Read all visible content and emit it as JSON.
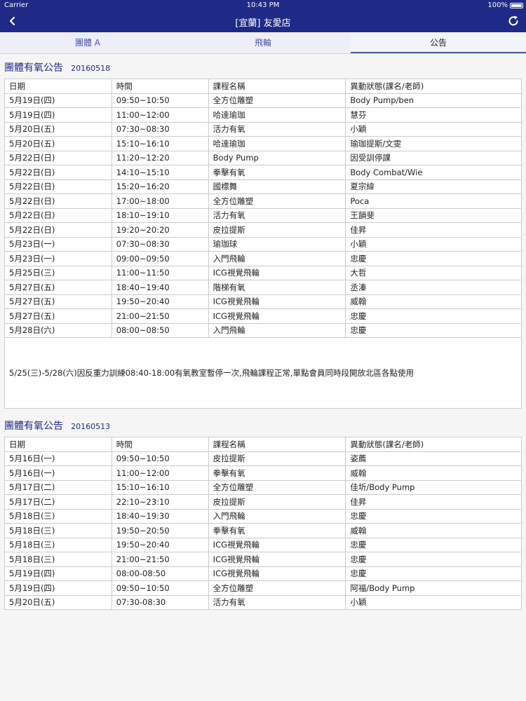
{
  "status_bar": {
    "carrier": "Carrier",
    "time": "10:43 PM",
    "battery": "100%"
  },
  "header": {
    "title": "[宜蘭] 友愛店",
    "back_icon": "chevron-left-icon",
    "refresh_icon": "refresh-icon"
  },
  "tabs": [
    {
      "label": "團體 A",
      "active": false
    },
    {
      "label": "飛輪",
      "active": false
    },
    {
      "label": "公告",
      "active": true
    }
  ],
  "announcements": [
    {
      "title": "團體有氧公告",
      "date": "20160518",
      "headers": [
        "日期",
        "時間",
        "課程名稱",
        "異動狀態(課名/老師)"
      ],
      "rows": [
        [
          "5月19日(四)",
          "09:50~10:50",
          "全方位雕塑",
          "Body Pump/ben"
        ],
        [
          "5月19日(四)",
          "11:00~12:00",
          "哈達瑜珈",
          "慧芬"
        ],
        [
          "5月20日(五)",
          "07:30~08:30",
          "活力有氧",
          "小穎"
        ],
        [
          "5月20日(五)",
          "15:10~16:10",
          "哈達瑜珈",
          "瑜珈提斯/文雯"
        ],
        [
          "5月22日(日)",
          "11:20~12:20",
          "Body Pump",
          "因受訓停課"
        ],
        [
          "5月22日(日)",
          "14:10~15:10",
          "拳擊有氧",
          "Body Combat/Wie"
        ],
        [
          "5月22日(日)",
          "15:20~16:20",
          "國標舞",
          "夏宗緯"
        ],
        [
          "5月22日(日)",
          "17:00~18:00",
          "全方位雕塑",
          "Poca"
        ],
        [
          "5月22日(日)",
          "18:10~19:10",
          "活力有氧",
          "王韻斐"
        ],
        [
          "5月22日(日)",
          "19:20~20:20",
          "皮拉提斯",
          "佳昇"
        ],
        [
          "5月23日(一)",
          "07:30~08:30",
          "瑜珈球",
          "小穎"
        ],
        [
          "5月23日(一)",
          "09:00~09:50",
          "入門飛輪",
          "忠慶"
        ],
        [
          "5月25日(三)",
          "11:00~11:50",
          "ICG視覺飛輪",
          "大哲"
        ],
        [
          "5月27日(五)",
          "18:40~19:40",
          "階梯有氧",
          "丞溱"
        ],
        [
          "5月27日(五)",
          "19:50~20:40",
          "ICG視覺飛輪",
          "威翰"
        ],
        [
          "5月27日(五)",
          "21:00~21:50",
          "ICG視覺飛輪",
          "忠慶"
        ],
        [
          "5月28日(六)",
          "08:00~08:50",
          "入門飛輪",
          "忠慶"
        ]
      ],
      "note": "5/25(三)-5/28(六)因反重力訓練08:40-18:00有氧教室暫停一次,飛輪課程正常,單點會員同時段開放北區各點使用"
    },
    {
      "title": "團體有氧公告",
      "date": "20160513",
      "headers": [
        "日期",
        "時間",
        "課程名稱",
        "異動狀態(課名/老師)"
      ],
      "rows": [
        [
          "5月16日(一)",
          "09:50~10:50",
          "皮拉提斯",
          "姿薦"
        ],
        [
          "5月16日(一)",
          "11:00~12:00",
          "拳擊有氧",
          "威翰"
        ],
        [
          "5月17日(二)",
          "15:10~16:10",
          "全方位雕塑",
          "佳圻/Body Pump"
        ],
        [
          "5月17日(二)",
          "22:10~23:10",
          "皮拉提斯",
          "佳昇"
        ],
        [
          "5月18日(三)",
          "18:40~19:30",
          "入門飛輪",
          "忠慶"
        ],
        [
          "5月18日(三)",
          "19:50~20:50",
          "拳擊有氧",
          "威翰"
        ],
        [
          "5月18日(三)",
          "19:50~20:40",
          "ICG視覺飛輪",
          "忠慶"
        ],
        [
          "5月18日(三)",
          "21:00~21:50",
          "ICG視覺飛輪",
          "忠慶"
        ],
        [
          "5月19日(四)",
          "08:00-08:50",
          "ICG視覺飛輪",
          "忠慶"
        ],
        [
          "5月19日(四)",
          "09:50~10:50",
          "全方位雕塑",
          "阿福/Body Pump"
        ],
        [
          "5月20日(五)",
          "07:30-08:30",
          "活力有氧",
          "小穎"
        ]
      ],
      "note": ""
    }
  ]
}
